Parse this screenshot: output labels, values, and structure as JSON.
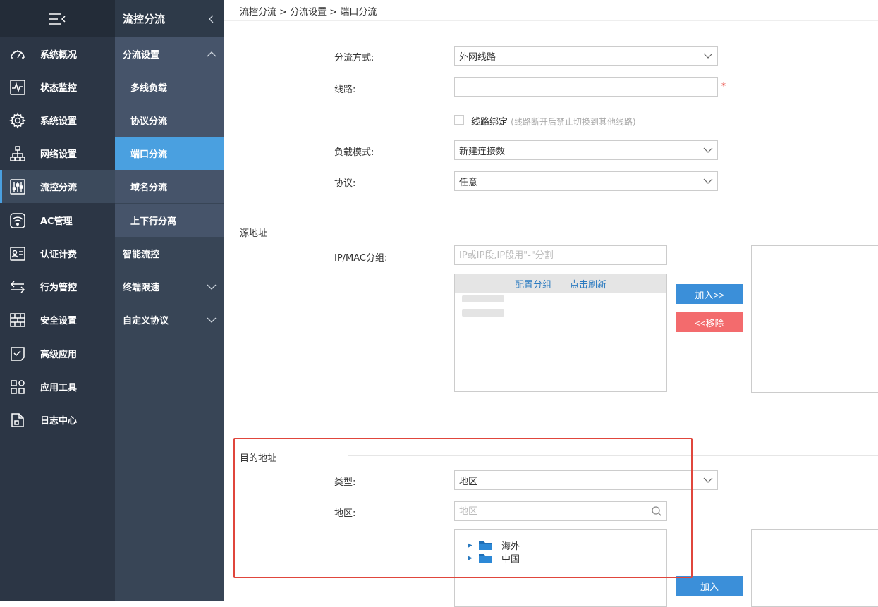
{
  "nav": {
    "items": [
      {
        "label": "系统概况",
        "icon": "dashboard-icon"
      },
      {
        "label": "状态监控",
        "icon": "monitor-icon"
      },
      {
        "label": "系统设置",
        "icon": "gear-icon"
      },
      {
        "label": "网络设置",
        "icon": "network-icon"
      },
      {
        "label": "流控分流",
        "icon": "sliders-icon"
      },
      {
        "label": "AC管理",
        "icon": "wifi-icon"
      },
      {
        "label": "认证计费",
        "icon": "id-card-icon"
      },
      {
        "label": "行为管控",
        "icon": "transfer-icon"
      },
      {
        "label": "安全设置",
        "icon": "firewall-icon"
      },
      {
        "label": "高级应用",
        "icon": "checklist-icon"
      },
      {
        "label": "应用工具",
        "icon": "apps-icon"
      },
      {
        "label": "日志中心",
        "icon": "document-icon"
      }
    ],
    "active_index": 4
  },
  "subnav": {
    "title": "流控分流",
    "items": [
      {
        "label": "分流设置",
        "level": 1,
        "chevron": "up"
      },
      {
        "label": "多线负载",
        "level": 2
      },
      {
        "label": "协议分流",
        "level": 2
      },
      {
        "label": "端口分流",
        "level": 2,
        "active": true
      },
      {
        "label": "域名分流",
        "level": 2
      },
      {
        "label": "上下行分离",
        "level": 2
      },
      {
        "label": "智能流控",
        "level": 1
      },
      {
        "label": "终端限速",
        "level": 1,
        "chevron": "down"
      },
      {
        "label": "自定义协议",
        "level": 1,
        "chevron": "down"
      }
    ]
  },
  "breadcrumb": "流控分流 > 分流设置 > 端口分流",
  "form": {
    "mode_label": "分流方式:",
    "mode_value": "外网线路",
    "line_label": "线路:",
    "line_value": "",
    "required_mark": "*",
    "bind_label": "线路绑定",
    "bind_hint": "(线路断开后禁止切换到其他线路)",
    "load_label": "负载模式:",
    "load_value": "新建连接数",
    "protocol_label": "协议:",
    "protocol_value": "任意"
  },
  "source": {
    "title": "源地址",
    "group_label": "IP/MAC分组:",
    "group_placeholder": "IP或IP段,IP段用\"-\"分割",
    "config_link": "配置分组",
    "refresh_link": "点击刷新",
    "add_button": "加入>>",
    "remove_button": "<<移除"
  },
  "destination": {
    "title": "目的地址",
    "type_label": "类型:",
    "type_value": "地区",
    "region_label": "地区:",
    "region_placeholder": "地区",
    "tree": [
      "海外",
      "中国"
    ],
    "add_button": "加入"
  },
  "colors": {
    "nav_bg": "#2c3645",
    "subnav_bg": "#384556",
    "accent": "#4aa0e0",
    "button_blue": "#3b8fd9",
    "button_red": "#f36b6d",
    "highlight": "#e0463c"
  }
}
